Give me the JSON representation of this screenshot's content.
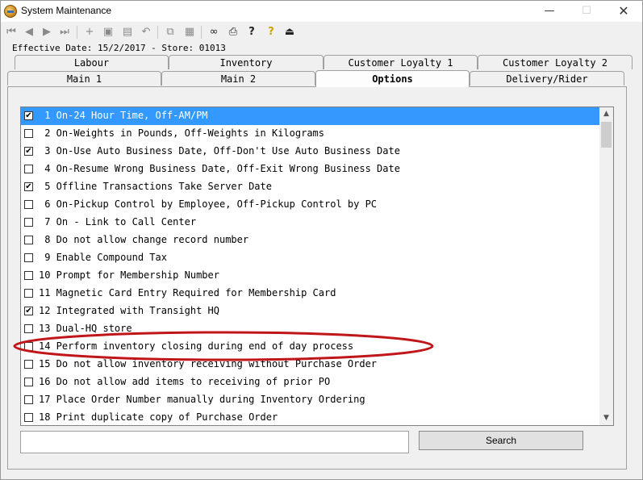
{
  "window": {
    "title": "System Maintenance",
    "minimize_glyph": "—",
    "maximize_glyph": "☐",
    "close_glyph": "✕"
  },
  "toolbar": {
    "buttons": [
      {
        "icon": "first-record-icon",
        "glyph": "⏮"
      },
      {
        "icon": "previous-record-icon",
        "glyph": "◀"
      },
      {
        "icon": "next-record-icon",
        "glyph": "▶"
      },
      {
        "icon": "last-record-icon",
        "glyph": "⏭"
      },
      {
        "icon": "add-icon",
        "glyph": "+"
      },
      {
        "icon": "edit-icon",
        "glyph": "▣"
      },
      {
        "icon": "save-icon",
        "glyph": "▤"
      },
      {
        "icon": "undo-icon",
        "glyph": "↶"
      },
      {
        "icon": "copy-icon",
        "glyph": "⧉"
      },
      {
        "icon": "paste-icon",
        "glyph": "▦"
      },
      {
        "icon": "binoculars-icon",
        "glyph": "∞"
      },
      {
        "icon": "printer-icon",
        "glyph": "⎙"
      },
      {
        "icon": "help-pointer-icon",
        "glyph": "?"
      },
      {
        "icon": "help-icon",
        "glyph": "?"
      },
      {
        "icon": "exit-door-icon",
        "glyph": "⏏"
      }
    ]
  },
  "effective_date_text": "Effective Date: 15/2/2017 - Store: 01013",
  "tabs": {
    "row1": [
      "Labour",
      "Inventory",
      "Customer Loyalty 1",
      "Customer Loyalty 2"
    ],
    "row2": [
      "Main 1",
      "Main 2",
      "Options",
      "Delivery/Rider"
    ],
    "active": "Options"
  },
  "options": [
    {
      "checked": true,
      "text": " 1 On-24 Hour Time, Off-AM/PM",
      "selected": true
    },
    {
      "checked": false,
      "text": " 2 On-Weights in Pounds, Off-Weights in Kilograms"
    },
    {
      "checked": true,
      "text": " 3 On-Use Auto Business Date, Off-Don't Use Auto Business Date"
    },
    {
      "checked": false,
      "text": " 4 On-Resume Wrong Business Date, Off-Exit Wrong Business Date"
    },
    {
      "checked": true,
      "text": " 5 Offline Transactions Take Server Date"
    },
    {
      "checked": false,
      "text": " 6 On-Pickup Control by Employee, Off-Pickup Control by PC"
    },
    {
      "checked": false,
      "text": " 7 On - Link to Call Center"
    },
    {
      "checked": false,
      "text": " 8 Do not allow change record number"
    },
    {
      "checked": false,
      "text": " 9 Enable Compound Tax"
    },
    {
      "checked": false,
      "text": "10 Prompt for Membership Number"
    },
    {
      "checked": false,
      "text": "11 Magnetic Card Entry Required for Membership Card"
    },
    {
      "checked": true,
      "text": "12 Integrated with Transight HQ"
    },
    {
      "checked": false,
      "text": "13 Dual-HQ store"
    },
    {
      "checked": false,
      "text": "14 Perform inventory closing during end of day process"
    },
    {
      "checked": false,
      "text": "15 Do not allow inventory receiving without Purchase Order"
    },
    {
      "checked": false,
      "text": "16 Do not allow add items to receiving of prior PO"
    },
    {
      "checked": false,
      "text": "17 Place Order Number manually during Inventory Ordering"
    },
    {
      "checked": false,
      "text": "18 Print duplicate copy of Purchase Order"
    }
  ],
  "search": {
    "value": "",
    "button_label": "Search"
  },
  "colors": {
    "selection": "#3399ff",
    "annotation_ellipse": "#c0161a"
  }
}
